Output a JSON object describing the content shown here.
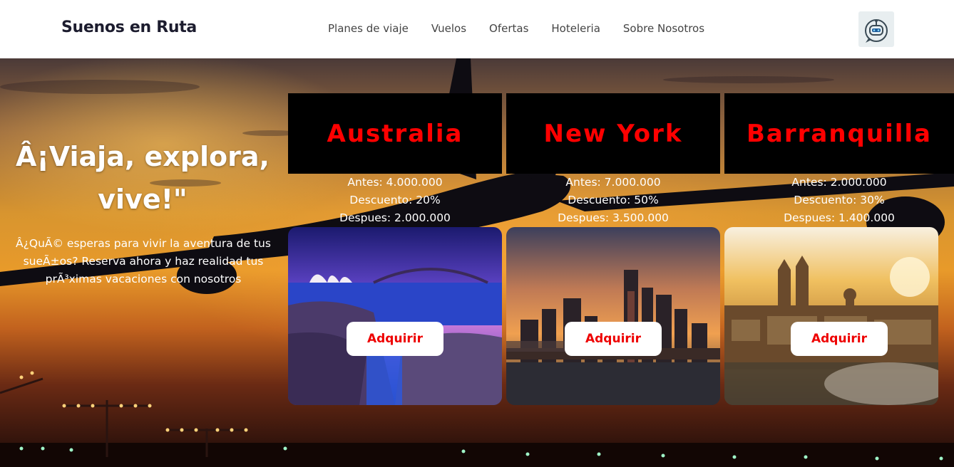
{
  "header": {
    "brand": "Suenos en Ruta",
    "nav": [
      "Planes de viaje",
      "Vuelos",
      "Ofertas",
      "Hoteleria",
      "Sobre Nosotros"
    ],
    "avatar_icon": "robot-chat-icon"
  },
  "hero": {
    "headline_line1": "Â¡Viaja, explora,",
    "headline_line2": "vive!\"",
    "subtext": "Â¿QuÃ© esperas para vivir la aventura de tus sueÃ±os? Reserva ahora y haz realidad tus prÃ³ximas vacaciones con nosotros"
  },
  "offers": [
    {
      "title": "Australia",
      "antes": "Antes: 4.000.000",
      "descuento": "Descuento: 20%",
      "despues": "Despues: 2.000.000",
      "button": "Adquirir"
    },
    {
      "title": "New York",
      "antes": "Antes: 7.000.000",
      "descuento": "Descuento: 50%",
      "despues": "Despues: 3.500.000",
      "button": "Adquirir"
    },
    {
      "title": "Barranquilla",
      "antes": "Antes: 2.000.000",
      "descuento": "Descuento: 30%",
      "despues": "Despues: 1.400.000",
      "button": "Adquirir"
    }
  ],
  "colors": {
    "accent": "#ff0000",
    "title_box": "#000000",
    "navbar": "#ffffff"
  }
}
